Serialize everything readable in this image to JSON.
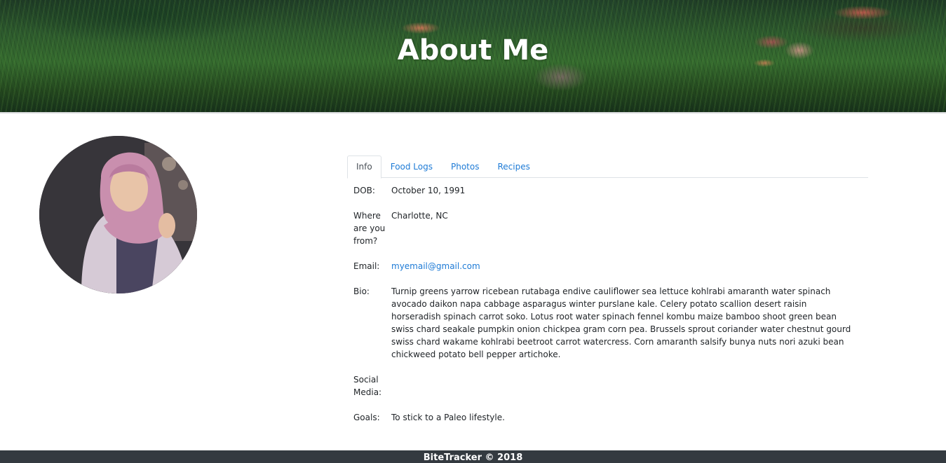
{
  "header": {
    "title": "About Me"
  },
  "profile": {
    "avatar_alt": "profile photo"
  },
  "tabs": [
    {
      "label": "Info",
      "active": true
    },
    {
      "label": "Food Logs",
      "active": false
    },
    {
      "label": "Photos",
      "active": false
    },
    {
      "label": "Recipes",
      "active": false
    }
  ],
  "info": {
    "dob_label": "DOB:",
    "dob_value": "October 10, 1991",
    "from_label": "Where are you from?",
    "from_value": "Charlotte, NC",
    "email_label": "Email:",
    "email_value": "myemail@gmail.com",
    "bio_label": "Bio:",
    "bio_value": "Turnip greens yarrow ricebean rutabaga endive cauliflower sea lettuce kohlrabi amaranth water spinach avocado daikon napa cabbage asparagus winter purslane kale. Celery potato scallion desert raisin horseradish spinach carrot soko. Lotus root water spinach fennel kombu maize bamboo shoot green bean swiss chard seakale pumpkin onion chickpea gram corn pea. Brussels sprout coriander water chestnut gourd swiss chard wakame kohlrabi beetroot carrot watercress. Corn amaranth salsify bunya nuts nori azuki bean chickweed potato bell pepper artichoke.",
    "social_label": "Social Media:",
    "social_value": "",
    "goals_label": "Goals:",
    "goals_value": "To stick to a Paleo lifestyle."
  },
  "footer": {
    "text": "BiteTracker © 2018"
  },
  "colors": {
    "link": "#1e7bd6",
    "footer_bg": "#343a40"
  }
}
